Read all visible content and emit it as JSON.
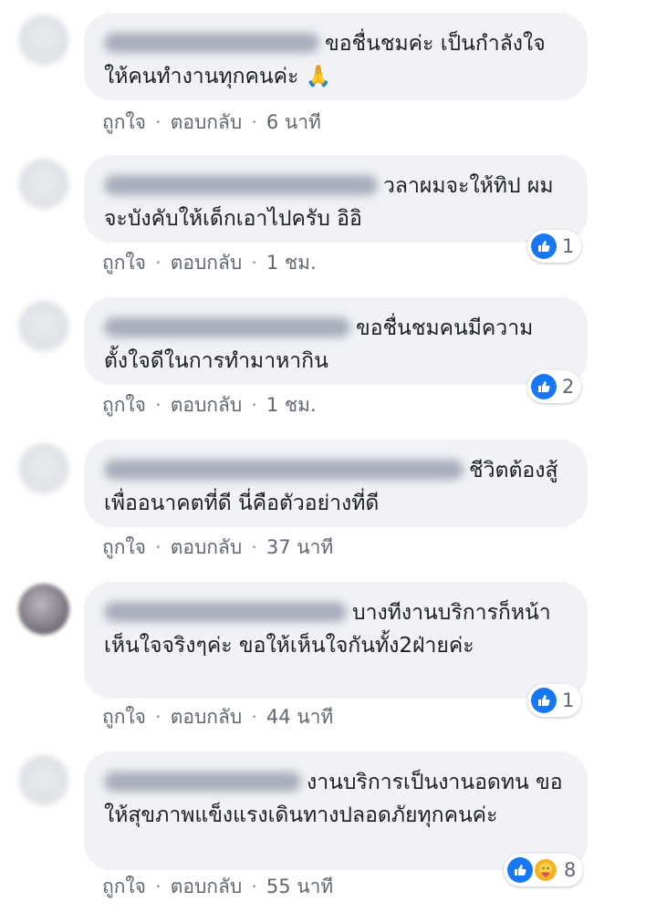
{
  "comments": [
    {
      "text": "ขอชื่นชมค่ะ เป็นกำลังใจให้คนทำงานทุกคนค่ะ 🙏",
      "like_label": "ถูกใจ",
      "reply_label": "ตอบกลับ",
      "time": "6 นาที"
    },
    {
      "text": "วลาผมจะให้ทิป ผมจะบังคับให้เด็กเอาไปครับ อิอิ",
      "like_label": "ถูกใจ",
      "reply_label": "ตอบกลับ",
      "time": "1 ชม.",
      "reaction_count": "1",
      "reactions": [
        "like-icon"
      ]
    },
    {
      "text": "ขอชื่นชมคนมีความตั้งใจดีในการทำมาหากิน",
      "like_label": "ถูกใจ",
      "reply_label": "ตอบกลับ",
      "time": "1 ชม.",
      "reaction_count": "2",
      "reactions": [
        "like-icon"
      ]
    },
    {
      "text": "ชีวิตต้องสู้ เพื่ออนาคตที่ดี นี่คือตัวอย่างที่ดี",
      "like_label": "ถูกใจ",
      "reply_label": "ตอบกลับ",
      "time": "37 นาที"
    },
    {
      "text": "บางทีงานบริการก็หน้าเห็นใจจริงๆค่ะ ขอให้เห็นใจกันทั้ง2ฝ่ายค่ะ",
      "like_label": "ถูกใจ",
      "reply_label": "ตอบกลับ",
      "time": "44 นาที",
      "reaction_count": "1",
      "reactions": [
        "like-icon"
      ]
    },
    {
      "text": "งานบริการเป็นงานอดทน ขอให้สุขภาพแข็งแรงเดินทางปลอดภัยทุกคนค่ะ",
      "like_label": "ถูกใจ",
      "reply_label": "ตอบกลับ",
      "time": "55 นาที",
      "reaction_count": "8",
      "reactions": [
        "like-icon",
        "care-icon"
      ]
    }
  ],
  "colors": {
    "bubble": "#f0f2f5",
    "meta_text": "#606770",
    "like_blue": "#1877f2",
    "care_yellow": "#f7b125"
  }
}
